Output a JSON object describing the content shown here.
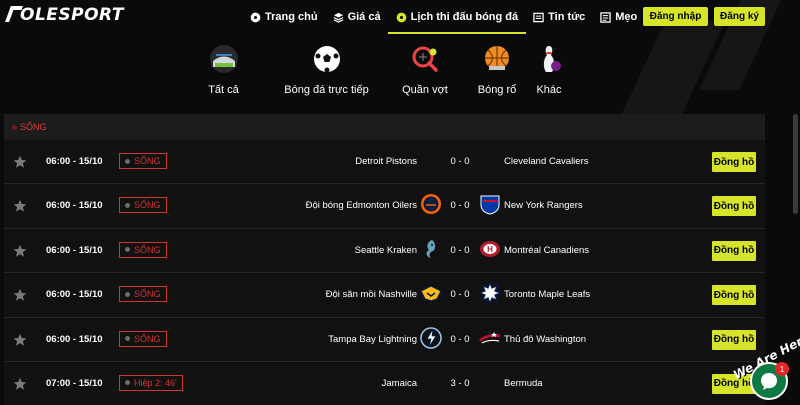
{
  "brand": {
    "name": "OLESPORT"
  },
  "nav": {
    "items": [
      {
        "label": "Trang chủ",
        "icon": "soccer-ball-icon"
      },
      {
        "label": "Giá cả",
        "icon": "layers-icon"
      },
      {
        "label": "Lịch thi đấu bóng đá",
        "icon": "soccer-ball-icon",
        "active": true
      },
      {
        "label": "Tin tức",
        "icon": "news-icon"
      },
      {
        "label": "Mẹo",
        "icon": "tips-icon"
      }
    ],
    "login_label": "Đăng nhập",
    "register_label": "Đăng ký"
  },
  "categories": [
    {
      "label": "Tất cả",
      "icon": "stadium-icon"
    },
    {
      "label": "Bóng đá trực tiếp",
      "icon": "soccer-ball-icon"
    },
    {
      "label": "Quần vợt",
      "icon": "tennis-icon"
    },
    {
      "label": "Bóng rổ",
      "icon": "basketball-icon"
    },
    {
      "label": "Khác",
      "icon": "bowling-icon"
    }
  ],
  "section": {
    "title": "SỐNG"
  },
  "matches": [
    {
      "time": "06:00 - 15/10",
      "status": "SỐNG",
      "home": "Detroit Pistons",
      "score": "0 - 0",
      "away": "Cleveland Cavaliers",
      "home_logo": "",
      "away_logo": "",
      "action": "Đồng hồ"
    },
    {
      "time": "06:00 - 15/10",
      "status": "SỐNG",
      "home": "Đội bóng Edmonton Oilers",
      "score": "0 - 0",
      "away": "New York Rangers",
      "home_logo": "oilers-logo-icon",
      "away_logo": "rangers-logo-icon",
      "action": "Đồng hồ"
    },
    {
      "time": "06:00 - 15/10",
      "status": "SỐNG",
      "home": "Seattle Kraken",
      "score": "0 - 0",
      "away": "Montréal Canadiens",
      "home_logo": "kraken-logo-icon",
      "away_logo": "canadiens-logo-icon",
      "action": "Đồng hồ"
    },
    {
      "time": "06:00 - 15/10",
      "status": "SỐNG",
      "home": "Đội săn mồi Nashville",
      "score": "0 - 0",
      "away": "Toronto Maple Leafs",
      "home_logo": "predators-logo-icon",
      "away_logo": "maple-leafs-logo-icon",
      "action": "Đồng hồ"
    },
    {
      "time": "06:00 - 15/10",
      "status": "SỐNG",
      "home": "Tampa Bay Lightning",
      "score": "0 - 0",
      "away": "Thủ đô Washington",
      "home_logo": "lightning-logo-icon",
      "away_logo": "capitals-logo-icon",
      "action": "Đồng hồ"
    },
    {
      "time": "07:00 - 15/10",
      "status": "Hiệp 2: 46'",
      "home": "Jamaica",
      "score": "3 - 0",
      "away": "Bermuda",
      "home_logo": "",
      "away_logo": "",
      "action": "Đồng hồ"
    }
  ],
  "chat": {
    "text": "We Are Here!",
    "badge": "1"
  },
  "colors": {
    "accent": "#d7e52a",
    "live_red": "#d23333",
    "background": "#0a0a0a"
  }
}
